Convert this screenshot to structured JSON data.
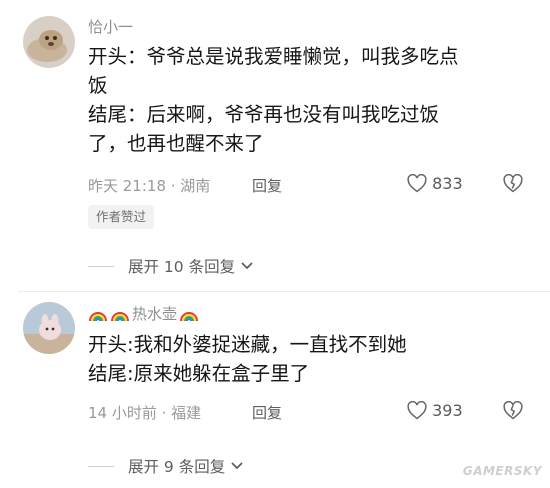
{
  "comments": [
    {
      "author": "恰小一",
      "lines": [
        "开头：爷爷总是说我爱睡懒觉，叫我多吃点",
        "饭",
        "结尾：后来啊，爷爷再也没有叫我吃过饭",
        "了，也再也醒不来了"
      ],
      "meta": "昨天 21:18 · 湖南",
      "reply_label": "回复",
      "likes": "833",
      "badge": "作者赞过",
      "expand_label": "展开 10 条回复"
    },
    {
      "author": "热水壶",
      "author_emoji": "rainbow",
      "lines": [
        "开头:我和外婆捉迷藏，一直找不到她",
        "结尾:原来她躲在盒子里了"
      ],
      "meta": "14 小时前 · 福建",
      "reply_label": "回复",
      "likes": "393",
      "expand_label": "展开 9 条回复"
    }
  ],
  "watermark": "GAMERSKY",
  "icons": {
    "heart": "heart-outline-icon",
    "dislike": "broken-heart-icon",
    "chevron": "chevron-down-icon",
    "rainbow": "rainbow-icon"
  }
}
